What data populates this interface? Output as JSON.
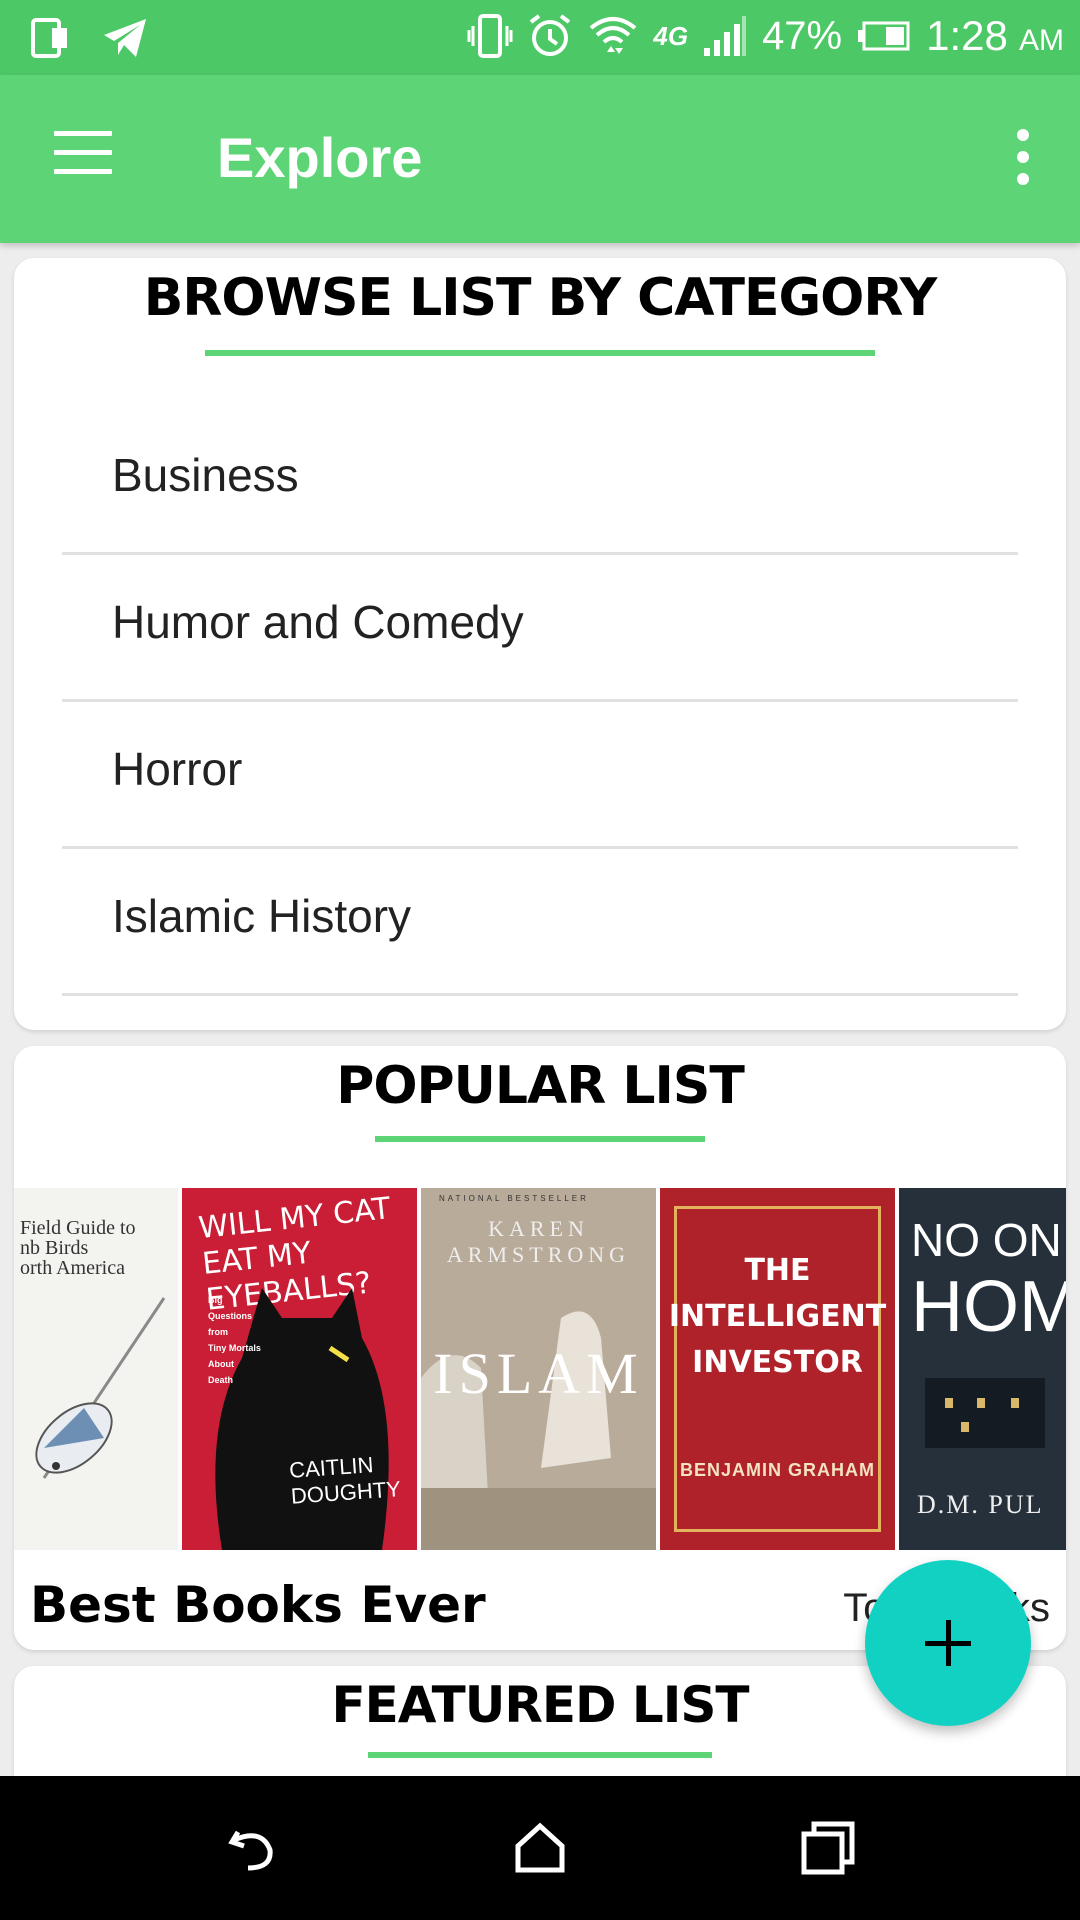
{
  "status_bar": {
    "battery_percent": "47%",
    "time": "1:28",
    "ampm": "AM",
    "network": "4G",
    "icons": [
      "sim-icon",
      "telegram-icon",
      "vibrate-icon",
      "alarm-icon",
      "wifi-icon",
      "signal-icon",
      "battery-icon"
    ]
  },
  "app_bar": {
    "title": "Explore",
    "menu_icon": "hamburger-menu-icon",
    "overflow_icon": "more-vert-icon"
  },
  "browse": {
    "title": "BROWSE LIST BY CATEGORY",
    "categories": [
      "Business",
      "Humor and Comedy",
      "Horror",
      "Islamic History"
    ]
  },
  "popular": {
    "title": "POPULAR LIST",
    "list_name": "Best Books Ever",
    "list_meta": "Total Books",
    "books": [
      {
        "title_lines": [
          "Field Guide to",
          "nb Birds",
          "orth America"
        ],
        "color": "#f3f3f0"
      },
      {
        "title": "WILL MY CAT EAT MY EYEBALLS?",
        "subtitle_lines": [
          "Big",
          "Questions",
          "from",
          "Tiny Mortals",
          "About",
          "Death"
        ],
        "author_lines": [
          "CAITLIN",
          "DOUGHTY"
        ],
        "color": "#c91e35"
      },
      {
        "badge": "NATIONAL BESTSELLER",
        "author_lines": [
          "KAREN",
          "ARMSTRONG"
        ],
        "title": "ISLAM",
        "color": "#b9ab9a"
      },
      {
        "title_lines": [
          "THE",
          "INTELLIGENT",
          "INVESTOR"
        ],
        "author": "BENJAMIN GRAHAM",
        "color": "#b0222a"
      },
      {
        "title_lines": [
          "NO ON",
          "HOM"
        ],
        "author": "D.M. PUL",
        "color": "#25303a"
      }
    ]
  },
  "featured": {
    "title": "FEATURED LIST"
  },
  "fab": {
    "icon": "plus-icon"
  },
  "colors": {
    "primary": "#5dd576",
    "status": "#4dc866",
    "accent": "#11d2c2"
  },
  "nav_bar": {
    "icons": [
      "back-icon",
      "home-icon",
      "recents-icon"
    ]
  }
}
